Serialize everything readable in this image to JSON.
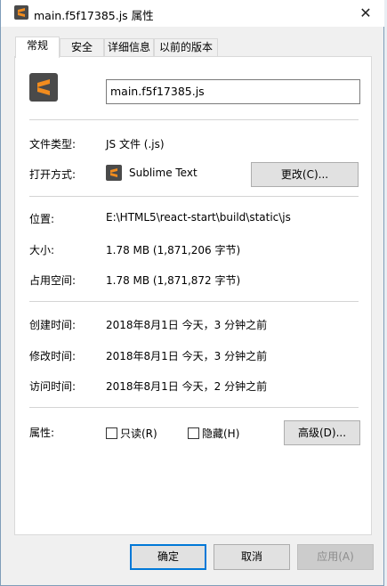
{
  "window": {
    "title": "main.f5f17385.js 属性",
    "close_glyph": "✕"
  },
  "tabs": [
    {
      "label": "常规",
      "active": true
    },
    {
      "label": "安全"
    },
    {
      "label": "详细信息"
    },
    {
      "label": "以前的版本"
    }
  ],
  "general": {
    "file_name": "main.f5f17385.js",
    "type_label": "文件类型:",
    "type_value": "JS 文件 (.js)",
    "opens_with_label": "打开方式:",
    "opens_with_value": "Sublime Text",
    "change_button": "更改(C)...",
    "location_label": "位置:",
    "location_value": "E:\\HTML5\\react-start\\build\\static\\js",
    "size_label": "大小:",
    "size_value": "1.78 MB (1,871,206 字节)",
    "disk_label": "占用空间:",
    "disk_value": "1.78 MB (1,871,872 字节)",
    "created_label": "创建时间:",
    "created_value": "2018年8月1日 今天，3 分钟之前",
    "modified_label": "修改时间:",
    "modified_value": "2018年8月1日 今天，3 分钟之前",
    "accessed_label": "访问时间:",
    "accessed_value": "2018年8月1日 今天，2 分钟之前",
    "attributes_label": "属性:",
    "readonly_label": "只读(R)",
    "hidden_label": "隐藏(H)",
    "advanced_button": "高级(D)..."
  },
  "footer": {
    "ok": "确定",
    "cancel": "取消",
    "apply": "应用(A)"
  },
  "icons": {
    "app_icon": "sublime-text-icon",
    "accent": "#f28c1e",
    "icon_bg": "#4a4a4a"
  }
}
